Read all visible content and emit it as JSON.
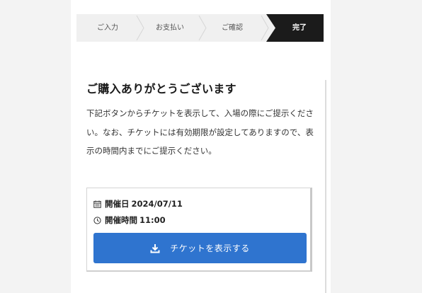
{
  "steps": [
    {
      "label": "ご入力"
    },
    {
      "label": "お支払い"
    },
    {
      "label": "ご確認"
    },
    {
      "label": "完了",
      "current": true
    }
  ],
  "icons": {
    "date": "calendar-icon",
    "time": "clock-icon",
    "download": "download-icon"
  },
  "colors": {
    "accent": "#2f74cf",
    "current_step": "#1b1b1b"
  },
  "main": {
    "title": "ご購入ありがとうございます",
    "description": "下記ボタンからチケットを表示して、入場の際にご提示ください。なお、チケットには有効期限が設定してありますので、表示の時間内までにご提示ください。"
  },
  "ticket": {
    "date_label": "開催日",
    "date_value": "2024/07/11",
    "time_label": "開催時間",
    "time_value": "11:00",
    "button_label": "チケットを表示する"
  }
}
